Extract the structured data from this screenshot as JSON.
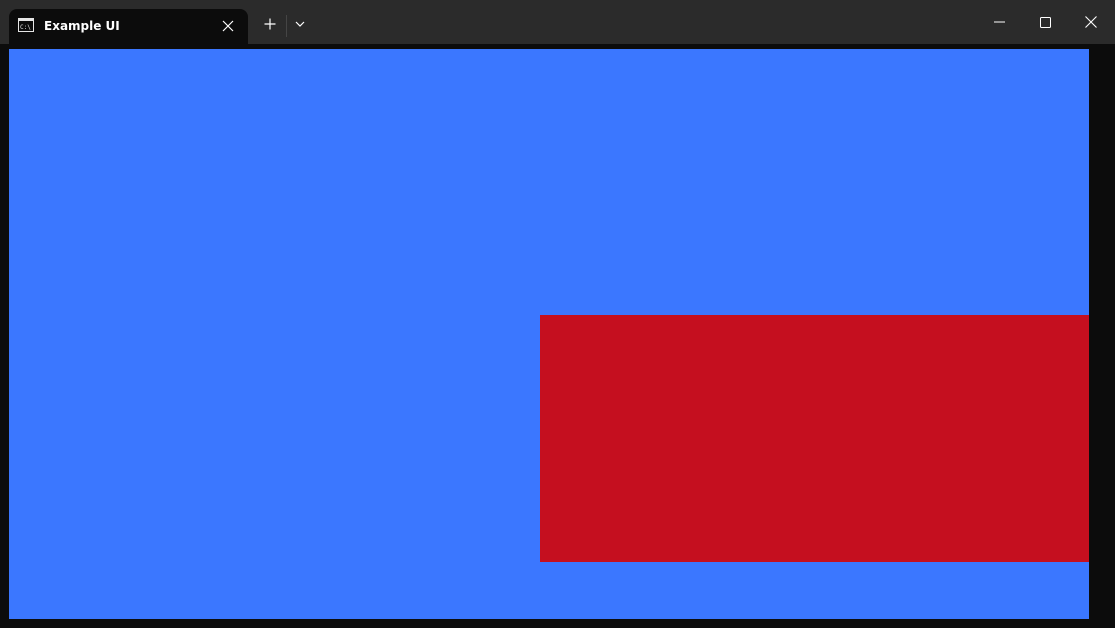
{
  "window": {
    "tab_title": "Example UI",
    "tab_icon": "terminal-icon"
  },
  "icons": {
    "tab_close": "close-icon",
    "new_tab": "plus-icon",
    "dropdown": "chevron-down-icon",
    "minimize": "minimize-icon",
    "maximize": "maximize-icon",
    "close": "close-icon"
  },
  "colors": {
    "titlebar": "#2b2b2b",
    "tab_active": "#0c0c0c",
    "canvas_background": "#3b77ff",
    "rectangle": "#c50f1f"
  }
}
